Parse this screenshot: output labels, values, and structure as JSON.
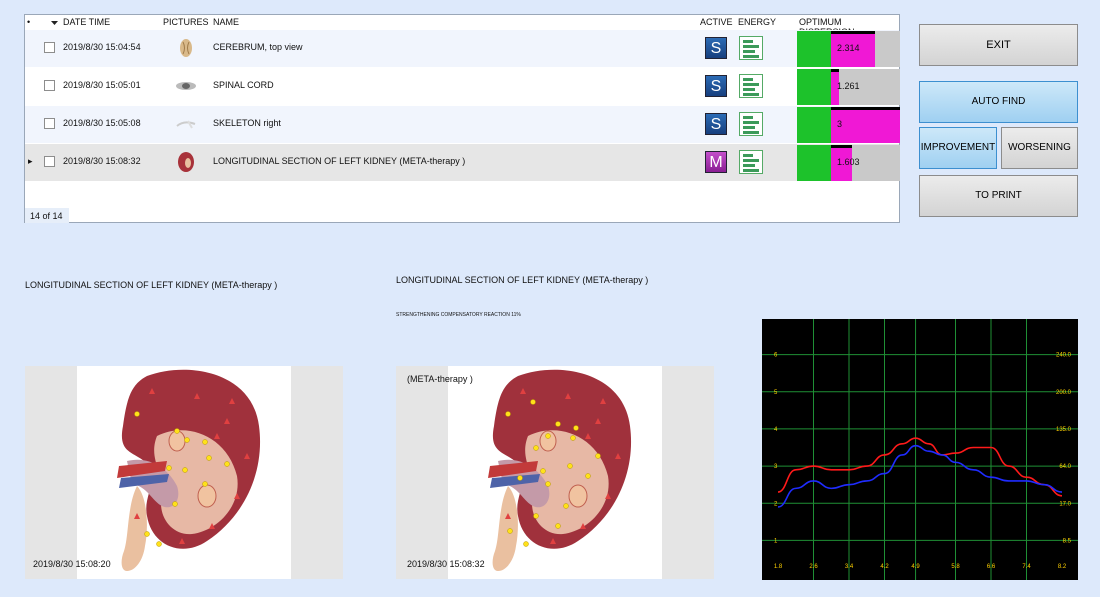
{
  "table": {
    "columns": {
      "sort_marker": "•",
      "date_time": "DATE TIME",
      "pictures": "PICTURES",
      "name": "NAME",
      "active": "ACTIVE",
      "energy": "ENERGY",
      "optimum_dispersion": "OPTIMUM DISPERSION"
    },
    "rows": [
      {
        "date_time": "2019/8/30 15:04:54",
        "name": "CEREBRUM, top view",
        "active": "S",
        "dispersion": "2.314",
        "green_frac": 0.33,
        "magenta_frac": 0.43
      },
      {
        "date_time": "2019/8/30 15:05:01",
        "name": "SPINAL CORD",
        "active": "S",
        "dispersion": "1.261",
        "green_frac": 0.33,
        "magenta_frac": 0.08
      },
      {
        "date_time": "2019/8/30 15:05:08",
        "name": "SKELETON right",
        "active": "S",
        "dispersion": "3",
        "green_frac": 0.33,
        "magenta_frac": 0.67
      },
      {
        "date_time": "2019/8/30 15:08:32",
        "name": "LONGITUDINAL  SECTION  OF  LEFT KIDNEY (META-therapy )",
        "active": "M",
        "dispersion": "1.603",
        "green_frac": 0.33,
        "magenta_frac": 0.2
      }
    ],
    "record_count": "14 of 14",
    "current_row_marker": "▸"
  },
  "buttons": {
    "exit": "EXIT",
    "auto_find": "AUTO FIND",
    "improvement": "IMPROVEMENT",
    "worsening": "WORSENING",
    "to_print": "TO PRINT"
  },
  "left_panel": {
    "title": "LONGITUDINAL  SECTION  OF  LEFT KIDNEY (META-therapy )",
    "timestamp": "2019/8/30 15:08:20"
  },
  "right_panel": {
    "title": "LONGITUDINAL  SECTION  OF  LEFT KIDNEY (META-therapy )",
    "note": "STRENGTHENING COMPENSATORY REACTION 11%",
    "image_caption": "(META-therapy )",
    "timestamp": "2019/8/30 15:08:32"
  },
  "colors": {
    "background": "#dde9fb",
    "accent_blue": "#9fd0f1",
    "dispersion_green": "#1dc22b",
    "dispersion_magenta": "#f018d5",
    "series_red": "#ff1a1a",
    "series_blue": "#1f2cff"
  },
  "chart_data": {
    "type": "line",
    "x_ticks": [
      "1.8",
      "2.6",
      "3.4",
      "4.2",
      "4.9",
      "5.8",
      "6.6",
      "7.4",
      "8.2"
    ],
    "y_left_ticks": [
      "1",
      "2",
      "3",
      "4",
      "5",
      "6"
    ],
    "y_right_ticks": [
      "8.5",
      "17.0",
      "64.0",
      "135.0",
      "200.0",
      "240.0"
    ],
    "xlim": [
      1.8,
      8.2
    ],
    "ylim": [
      0.5,
      6.5
    ],
    "grid": true,
    "series": [
      {
        "color": "red",
        "x": [
          1.8,
          2.2,
          2.6,
          3.0,
          3.4,
          3.8,
          4.2,
          4.6,
          4.9,
          5.2,
          5.5,
          5.8,
          6.2,
          6.6,
          7.0,
          7.4,
          7.8,
          8.2
        ],
        "y": [
          2.3,
          2.9,
          3.0,
          2.9,
          2.9,
          3.0,
          3.3,
          3.6,
          3.75,
          3.6,
          3.3,
          3.35,
          3.5,
          3.5,
          3.0,
          2.7,
          2.5,
          2.2
        ]
      },
      {
        "color": "blue",
        "x": [
          1.8,
          2.2,
          2.6,
          3.0,
          3.4,
          3.8,
          4.2,
          4.6,
          4.9,
          5.2,
          5.5,
          5.8,
          6.2,
          6.6,
          7.0,
          7.4,
          7.8,
          8.2
        ],
        "y": [
          1.9,
          2.4,
          2.6,
          2.4,
          2.5,
          2.6,
          2.8,
          3.3,
          3.55,
          3.4,
          3.3,
          3.1,
          2.9,
          2.7,
          2.6,
          2.6,
          2.5,
          2.3
        ]
      }
    ]
  }
}
